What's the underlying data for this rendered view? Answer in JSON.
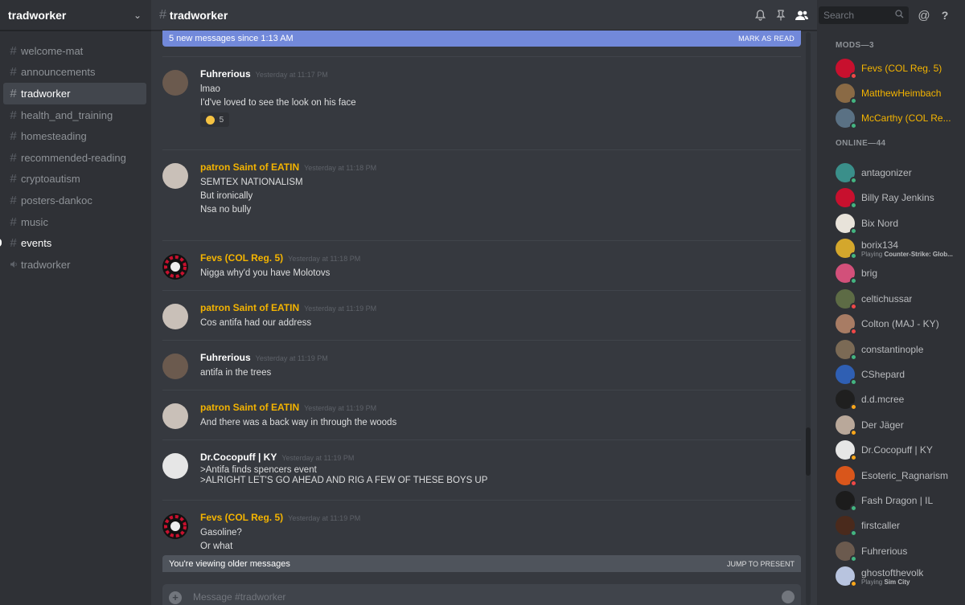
{
  "server": {
    "name": "tradworker"
  },
  "channels": [
    {
      "name": "welcome-mat",
      "type": "text",
      "state": "normal"
    },
    {
      "name": "announcements",
      "type": "text",
      "state": "normal"
    },
    {
      "name": "tradworker",
      "type": "text",
      "state": "active"
    },
    {
      "name": "health_and_training",
      "type": "text",
      "state": "normal"
    },
    {
      "name": "homesteading",
      "type": "text",
      "state": "normal"
    },
    {
      "name": "recommended-reading",
      "type": "text",
      "state": "normal"
    },
    {
      "name": "cryptoautism",
      "type": "text",
      "state": "normal"
    },
    {
      "name": "posters-dankoc",
      "type": "text",
      "state": "normal"
    },
    {
      "name": "music",
      "type": "text",
      "state": "normal"
    },
    {
      "name": "events",
      "type": "text",
      "state": "unread"
    },
    {
      "name": "tradworker",
      "type": "voice",
      "state": "normal"
    }
  ],
  "topbar": {
    "channel": "tradworker",
    "search_placeholder": "Search",
    "icons": [
      "bell-icon",
      "pin-icon",
      "members-icon",
      "search-icon",
      "mention-icon",
      "help-icon"
    ]
  },
  "banner": {
    "text": "5 new messages since 1:13 AM",
    "action": "MARK AS READ"
  },
  "messages": [
    {
      "author": "Fuhrerious",
      "time": "Yesterday at 11:17 PM",
      "gold": false,
      "lines": [
        "lmao",
        "I'd've loved to see the look on his face"
      ],
      "reaction": {
        "count": "5",
        "emoji": "grinning-sweat-icon"
      },
      "avatar_color": "#6b5a4e"
    },
    {
      "author": "patron Saint of EATIN",
      "time": "Yesterday at 11:18 PM",
      "gold": true,
      "lines": [
        "SEMTEX NATIONALISM",
        "But ironically",
        "Nsa no bully"
      ],
      "avatar_color": "#c9c0b8"
    },
    {
      "author": "Fevs (COL Reg. 5)",
      "time": "Yesterday at 11:18 PM",
      "gold": true,
      "lines": [
        "Nigga why'd you have Molotovs"
      ],
      "avatar_color": "#c8102e"
    },
    {
      "author": "patron Saint of EATIN",
      "time": "Yesterday at 11:19 PM",
      "gold": true,
      "lines": [
        "Cos antifa had our address"
      ],
      "avatar_color": "#c9c0b8"
    },
    {
      "author": "Fuhrerious",
      "time": "Yesterday at 11:19 PM",
      "gold": false,
      "lines": [
        "antifa in the trees"
      ],
      "avatar_color": "#6b5a4e"
    },
    {
      "author": "patron Saint of EATIN",
      "time": "Yesterday at 11:19 PM",
      "gold": true,
      "lines": [
        "And there was a back way in through the woods"
      ],
      "avatar_color": "#c9c0b8"
    },
    {
      "author": "Dr.Cocopuff | KY",
      "time": "Yesterday at 11:19 PM",
      "gold": false,
      "lines": [
        ">Antifa finds spencers event",
        ">ALRIGHT LET'S GO AHEAD AND RIG A FEW OF THESE BOYS UP"
      ],
      "avatar_color": "#e6e6e6"
    },
    {
      "author": "Fevs (COL Reg. 5)",
      "time": "Yesterday at 11:19 PM",
      "gold": true,
      "lines": [
        "Gasoline?",
        "Or what"
      ],
      "avatar_color": "#c8102e"
    }
  ],
  "older_banner": {
    "text": "You're viewing older messages",
    "action": "JUMP TO PRESENT"
  },
  "composer": {
    "placeholder": "Message #tradworker"
  },
  "members": {
    "groups": [
      {
        "title": "MODS—3",
        "items": [
          {
            "name": "Fevs (COL Reg. 5)",
            "gold": true,
            "status": "dnd",
            "avatar_color": "#c8102e"
          },
          {
            "name": "MatthewHeimbach",
            "gold": true,
            "status": "online",
            "avatar_color": "#8a6a45"
          },
          {
            "name": "McCarthy (COL Re...",
            "gold": true,
            "status": "online",
            "avatar_color": "#5a7184"
          }
        ]
      },
      {
        "title": "ONLINE—44",
        "items": [
          {
            "name": "antagonizer",
            "status": "online",
            "avatar_color": "#3a8f8a"
          },
          {
            "name": "Billy Ray Jenkins",
            "status": "online",
            "avatar_color": "#c8102e"
          },
          {
            "name": "Bix Nord",
            "status": "online",
            "avatar_color": "#e8e3da"
          },
          {
            "name": "borix134",
            "status": "online",
            "avatar_color": "#d4a72c",
            "activity_prefix": "Playing",
            "activity": "Counter-Strike: Glob..."
          },
          {
            "name": "brig",
            "status": "online",
            "avatar_color": "#d2507a"
          },
          {
            "name": "celtichussar",
            "status": "dnd",
            "avatar_color": "#5d6b45"
          },
          {
            "name": "Colton (MAJ - KY)",
            "status": "dnd",
            "avatar_color": "#a87c64"
          },
          {
            "name": "constantinople",
            "status": "online",
            "avatar_color": "#7b6a55"
          },
          {
            "name": "CShepard",
            "status": "online",
            "avatar_color": "#2f5fb3"
          },
          {
            "name": "d.d.mcree",
            "status": "idle",
            "avatar_color": "#1f1f1f"
          },
          {
            "name": "Der Jäger",
            "status": "idle",
            "avatar_color": "#b9a89a"
          },
          {
            "name": "Dr.Cocopuff | KY",
            "status": "idle",
            "avatar_color": "#e6e6e6"
          },
          {
            "name": "Esoteric_Ragnarism",
            "status": "dnd",
            "avatar_color": "#d9561b"
          },
          {
            "name": "Fash Dragon | IL",
            "status": "online",
            "avatar_color": "#1c1c1c"
          },
          {
            "name": "firstcaller",
            "status": "online",
            "avatar_color": "#4a2a1c"
          },
          {
            "name": "Fuhrerious",
            "status": "online",
            "avatar_color": "#6b5a4e"
          },
          {
            "name": "ghostofthevolk",
            "status": "idle",
            "avatar_color": "#b8c4df",
            "activity_prefix": "Playing",
            "activity": "Sim City"
          }
        ]
      }
    ]
  }
}
